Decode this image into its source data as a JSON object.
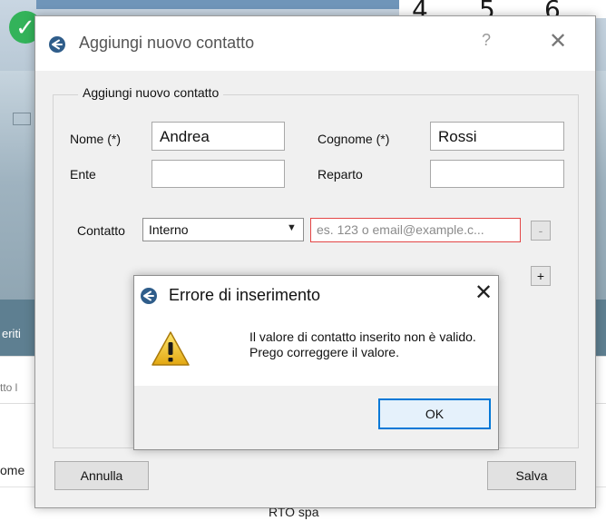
{
  "background": {
    "calendar_digits": [
      "4",
      "5",
      "6"
    ],
    "sidebar_label": "eriti",
    "search_hint": "tto l",
    "column_label": "ome",
    "footer_text": "RTO spa"
  },
  "dialog": {
    "title": "Aggiungi nuovo contatto",
    "help_glyph": "?",
    "close_glyph": "✕",
    "group_title": "Aggiungi nuovo contatto",
    "fields": {
      "nome_label": "Nome (*)",
      "nome_value": "Andrea",
      "cognome_label": "Cognome (*)",
      "cognome_value": "Rossi",
      "ente_label": "Ente",
      "ente_value": "",
      "reparto_label": "Reparto",
      "reparto_value": ""
    },
    "contatto_label": "Contatto",
    "contatto_type": "Interno",
    "contatto_placeholder": "es. 123 o email@example.c...",
    "remove_button": "-",
    "add_button": "+",
    "cancel_button": "Annulla",
    "save_button": "Salva"
  },
  "error_dialog": {
    "title": "Errore di inserimento",
    "close_glyph": "✕",
    "message_line1": "Il valore di contatto inserito non è valido.",
    "message_line2": "Prego correggere il valore.",
    "ok_button": "OK"
  },
  "colors": {
    "accent": "#0078d7",
    "error_border": "#e34646",
    "success": "#33b35a",
    "app_icon": "#2f5d8a"
  }
}
